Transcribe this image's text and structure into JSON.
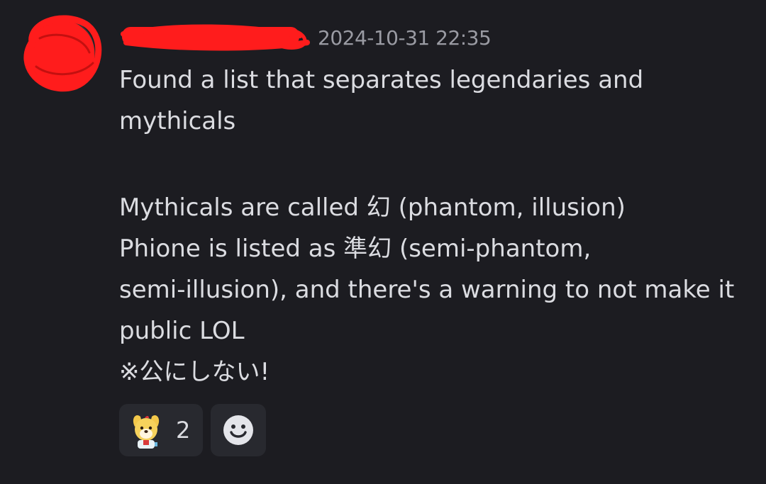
{
  "message": {
    "timestamp": "2024-10-31 22:35",
    "lines": [
      "Found a list that separates legendaries and",
      "mythicals",
      "",
      "Mythicals are called 幻 (phantom, illusion)",
      "Phione is listed as 準幻 (semi-phantom,",
      "semi-illusion), and there's a warning to not make it",
      "public LOL",
      "※公にしない!"
    ]
  },
  "reactions": [
    {
      "emoji": "isabelle-emoji",
      "count": "2"
    },
    {
      "emoji": "add-reaction-icon"
    }
  ],
  "colors": {
    "background": "#1c1c21",
    "text": "#dbdce1",
    "muted": "#9a9ba3",
    "pill": "#28292f",
    "redaction": "#ff1c1c"
  }
}
